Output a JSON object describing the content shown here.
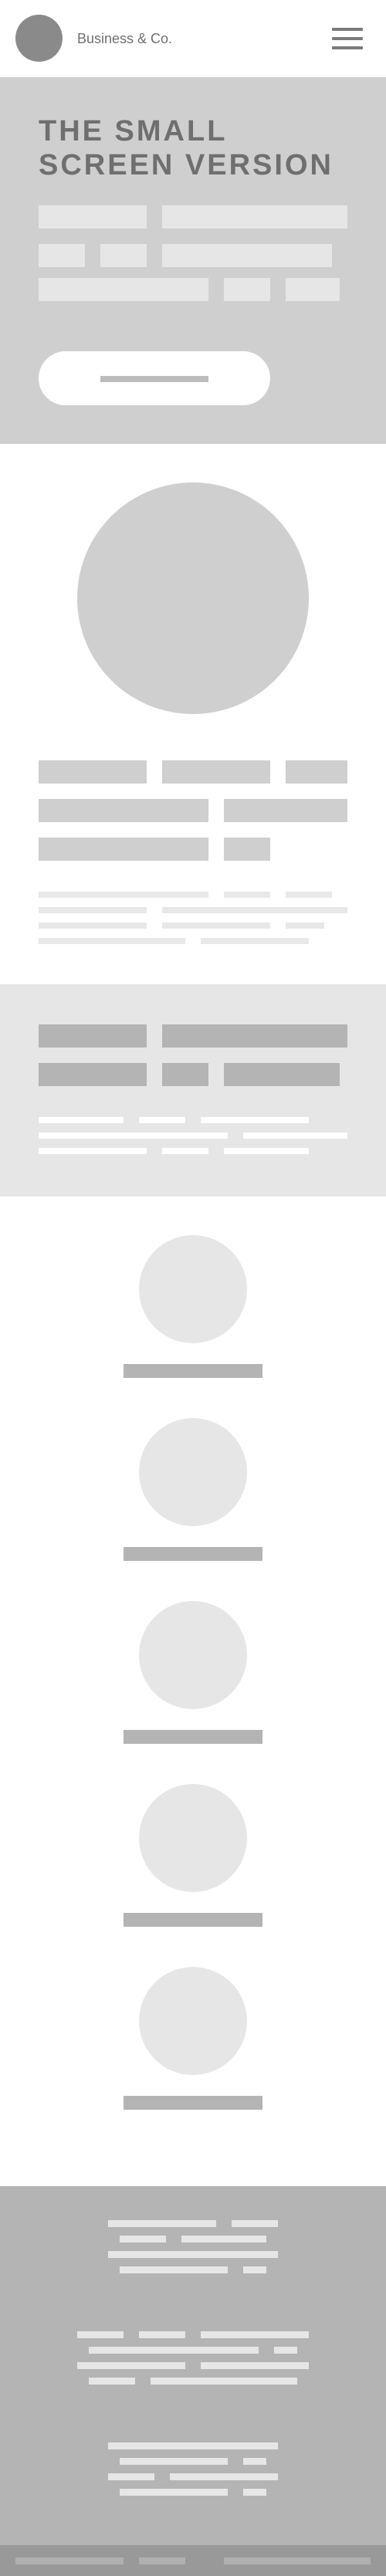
{
  "header": {
    "brand": "Business & Co.",
    "logo_icon": "circle-logo-icon",
    "menu_icon": "hamburger-menu-icon"
  },
  "hero": {
    "title_line1": "THE SMALL",
    "title_line2": "SCREEN VERSION"
  },
  "avatars": {
    "count_visible": 5
  },
  "colors": {
    "hero_bg": "#cfcfcf",
    "band_bg": "#e6e6e6",
    "footer_bg": "#b4b4b4",
    "bottom_bar_bg": "#999999",
    "title_text": "#6f6f6f"
  }
}
